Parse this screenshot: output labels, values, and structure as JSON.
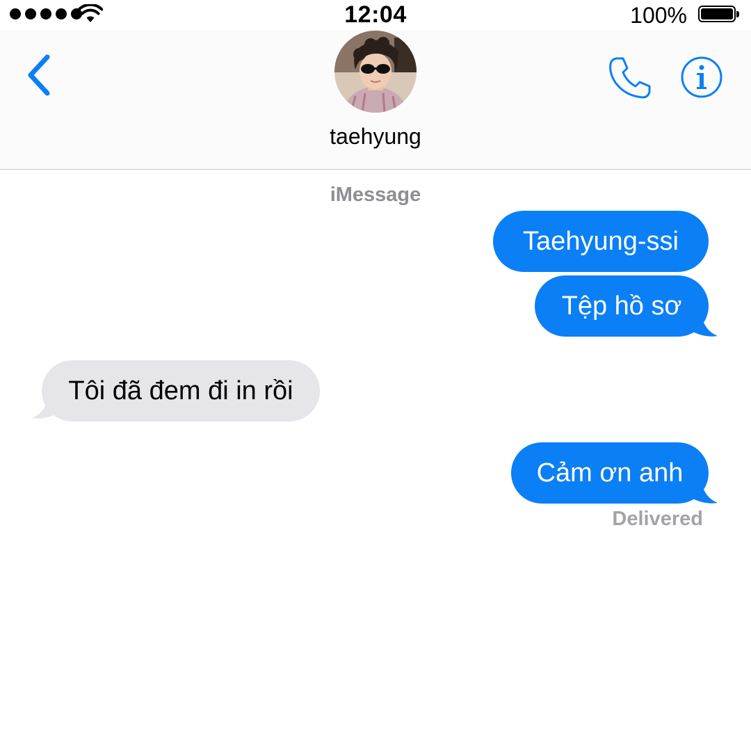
{
  "status_bar": {
    "time": "12:04",
    "battery_percent": "100%",
    "signal_bars": 5,
    "wifi_icon": "wifi-icon",
    "battery_icon": "battery-icon"
  },
  "header": {
    "back_icon": "chevron-left-icon",
    "contact_name": "taehyung",
    "phone_icon": "phone-icon",
    "info_icon": "info-icon"
  },
  "conversation": {
    "service_label": "iMessage",
    "messages": [
      {
        "direction": "sent",
        "text": "Taehyung-ssi"
      },
      {
        "direction": "sent",
        "text": "Tệp hồ sơ"
      },
      {
        "direction": "received",
        "text": "Tôi đã đem đi in rồi"
      },
      {
        "direction": "sent",
        "text": "Cảm ơn anh"
      }
    ],
    "delivery_status": "Delivered"
  },
  "colors": {
    "accent": "#0b7ff5",
    "sent_bubble": "#0b7ff5",
    "received_bubble": "#e5e5ea",
    "secondary_text": "#8e8e93"
  }
}
